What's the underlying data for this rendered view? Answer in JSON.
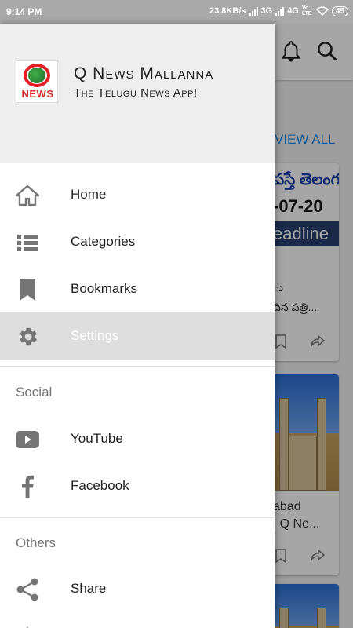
{
  "status_bar": {
    "time": "9:14 PM",
    "net_speed": "23.8KB/s",
    "network_3g": "3G",
    "network_4g": "4G",
    "volte": "Vo LTE",
    "battery": "45"
  },
  "drawer": {
    "app_name": "Q News Mallanna",
    "tagline": "The Telugu News App!",
    "logo_text": "NEWS",
    "main_items": [
      {
        "label": "Home",
        "icon": "home-icon"
      },
      {
        "label": "Categories",
        "icon": "list-icon"
      },
      {
        "label": "Bookmarks",
        "icon": "bookmark-icon"
      },
      {
        "label": "Settings",
        "icon": "gear-icon",
        "selected": true
      }
    ],
    "social_title": "Social",
    "social_items": [
      {
        "label": "YouTube",
        "icon": "youtube-icon"
      },
      {
        "label": "Facebook",
        "icon": "facebook-icon"
      }
    ],
    "others_title": "Others",
    "other_items": [
      {
        "label": "Share",
        "icon": "share-icon"
      }
    ]
  },
  "background": {
    "view_all": "VIEW ALL",
    "card1": {
      "line1": "పస్తే తెలంగ",
      "line2": "-07-20",
      "line3": "eadline",
      "caption1": "ు",
      "caption2": "దిన పత్రి..."
    },
    "card2": {
      "caption1": "abad",
      "caption2": "| Q Ne..."
    }
  },
  "colors": {
    "accent": "#1e88e5",
    "status_bar": "#a9a9a9",
    "drawer_header": "#eeeeee",
    "selected_item": "#dedede",
    "icon": "#757575"
  }
}
